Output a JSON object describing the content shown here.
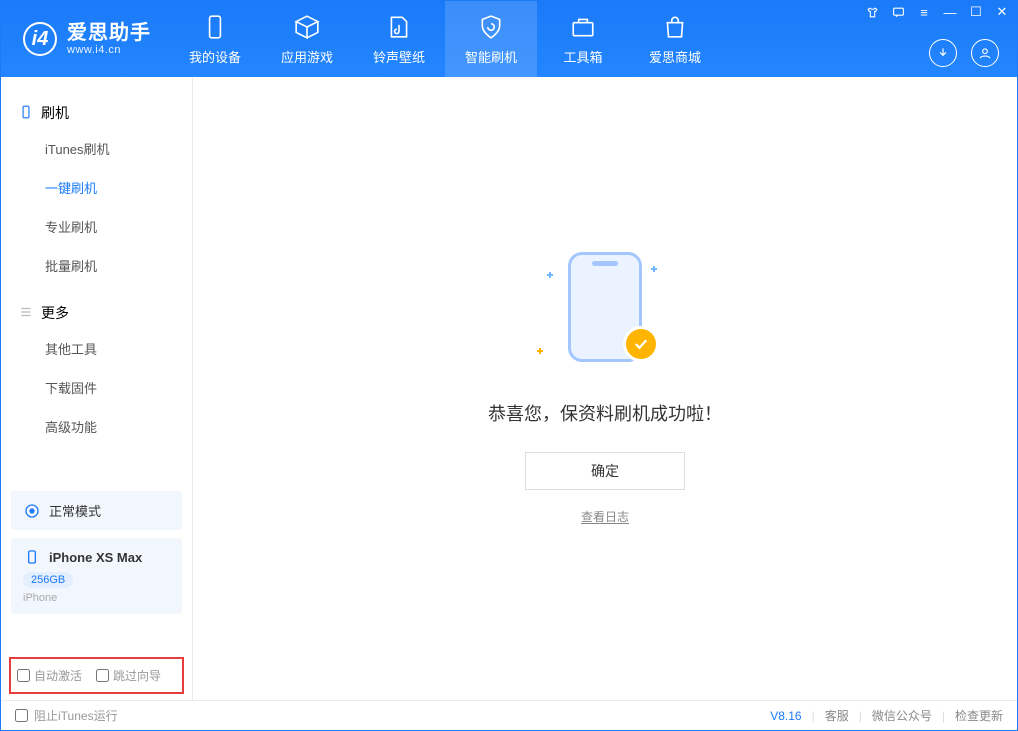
{
  "app": {
    "title": "爱思助手",
    "subtitle": "www.i4.cn"
  },
  "nav": {
    "items": [
      {
        "label": "我的设备"
      },
      {
        "label": "应用游戏"
      },
      {
        "label": "铃声壁纸"
      },
      {
        "label": "智能刷机"
      },
      {
        "label": "工具箱"
      },
      {
        "label": "爱思商城"
      }
    ]
  },
  "sidebar": {
    "group1": {
      "title": "刷机",
      "items": [
        "iTunes刷机",
        "一键刷机",
        "专业刷机",
        "批量刷机"
      ]
    },
    "group2": {
      "title": "更多",
      "items": [
        "其他工具",
        "下载固件",
        "高级功能"
      ]
    },
    "mode_card": "正常模式",
    "device": {
      "name": "iPhone XS Max",
      "storage": "256GB",
      "type": "iPhone"
    },
    "checks": {
      "auto_activate": "自动激活",
      "skip_guide": "跳过向导"
    }
  },
  "main": {
    "success_msg": "恭喜您，保资料刷机成功啦！",
    "ok_button": "确定",
    "log_link": "查看日志"
  },
  "footer": {
    "block_itunes": "阻止iTunes运行",
    "version": "V8.16",
    "links": [
      "客服",
      "微信公众号",
      "检查更新"
    ]
  }
}
